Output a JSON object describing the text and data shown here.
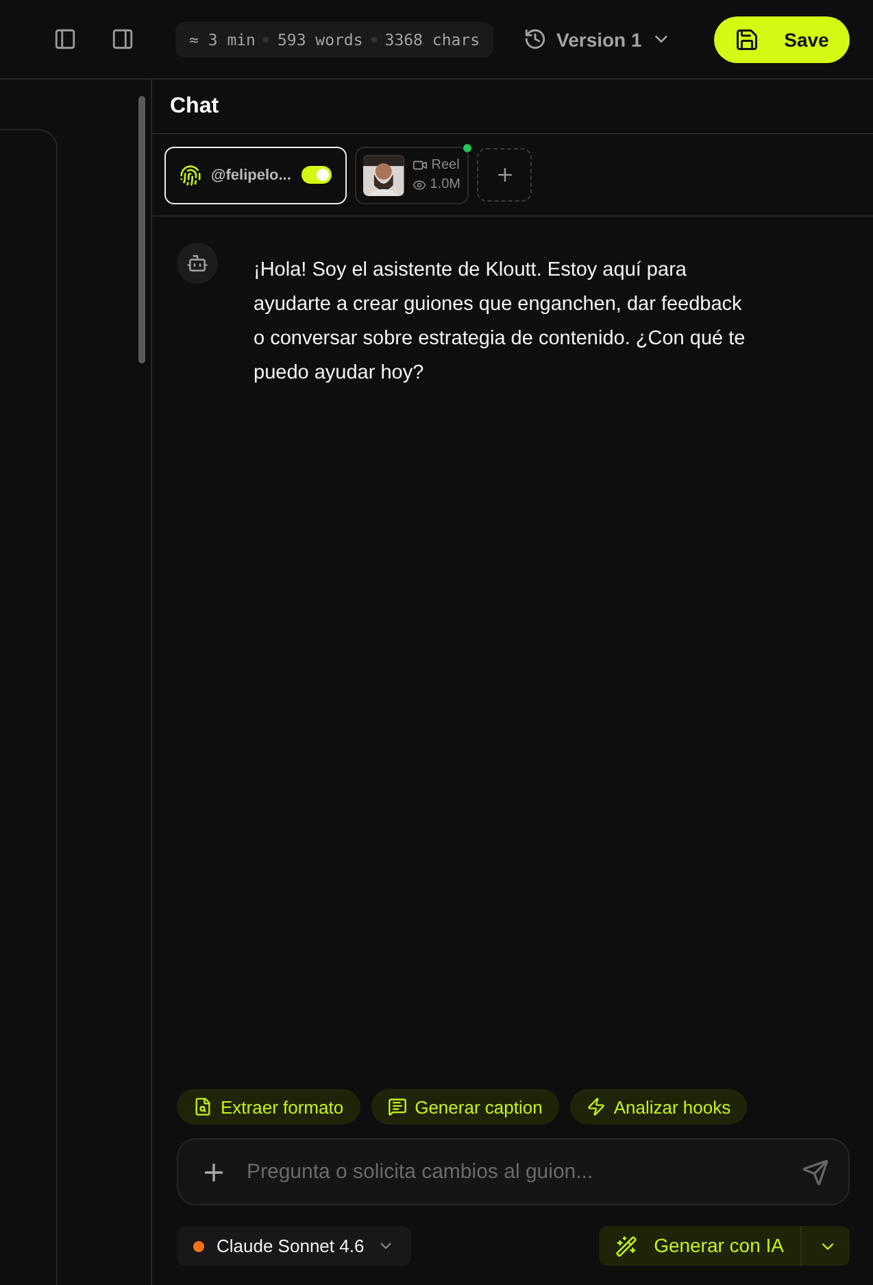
{
  "toolbar": {
    "stats": [
      "≈ 3 min",
      "593 words",
      "3368 chars"
    ],
    "version": "Version 1",
    "save": "Save"
  },
  "chat": {
    "title": "Chat",
    "sources": [
      {
        "kind": "account",
        "handle": "@felipelo...",
        "on": true,
        "selected": true
      },
      {
        "kind": "video",
        "type": "Reel",
        "views": "1.0M",
        "selected": false
      }
    ],
    "message": "¡Hola! Soy el asistente de Kloutt. Estoy aquí para ayudarte a crear guiones que enganchen, dar feedback o conversar sobre estrategia de contenido. ¿Con qué te puedo ayudar hoy?",
    "quick_actions": [
      {
        "kind": "format",
        "label": "Extraer formato"
      },
      {
        "kind": "caption",
        "label": "Generar caption"
      },
      {
        "kind": "hooks",
        "label": "Analizar hooks"
      }
    ],
    "input": {
      "placeholder": "Pregunta o solicita cambios al guion..."
    },
    "model": {
      "name": "Claude Sonnet 4.6",
      "color": "#f97316"
    },
    "generate": "Generar con IA"
  }
}
